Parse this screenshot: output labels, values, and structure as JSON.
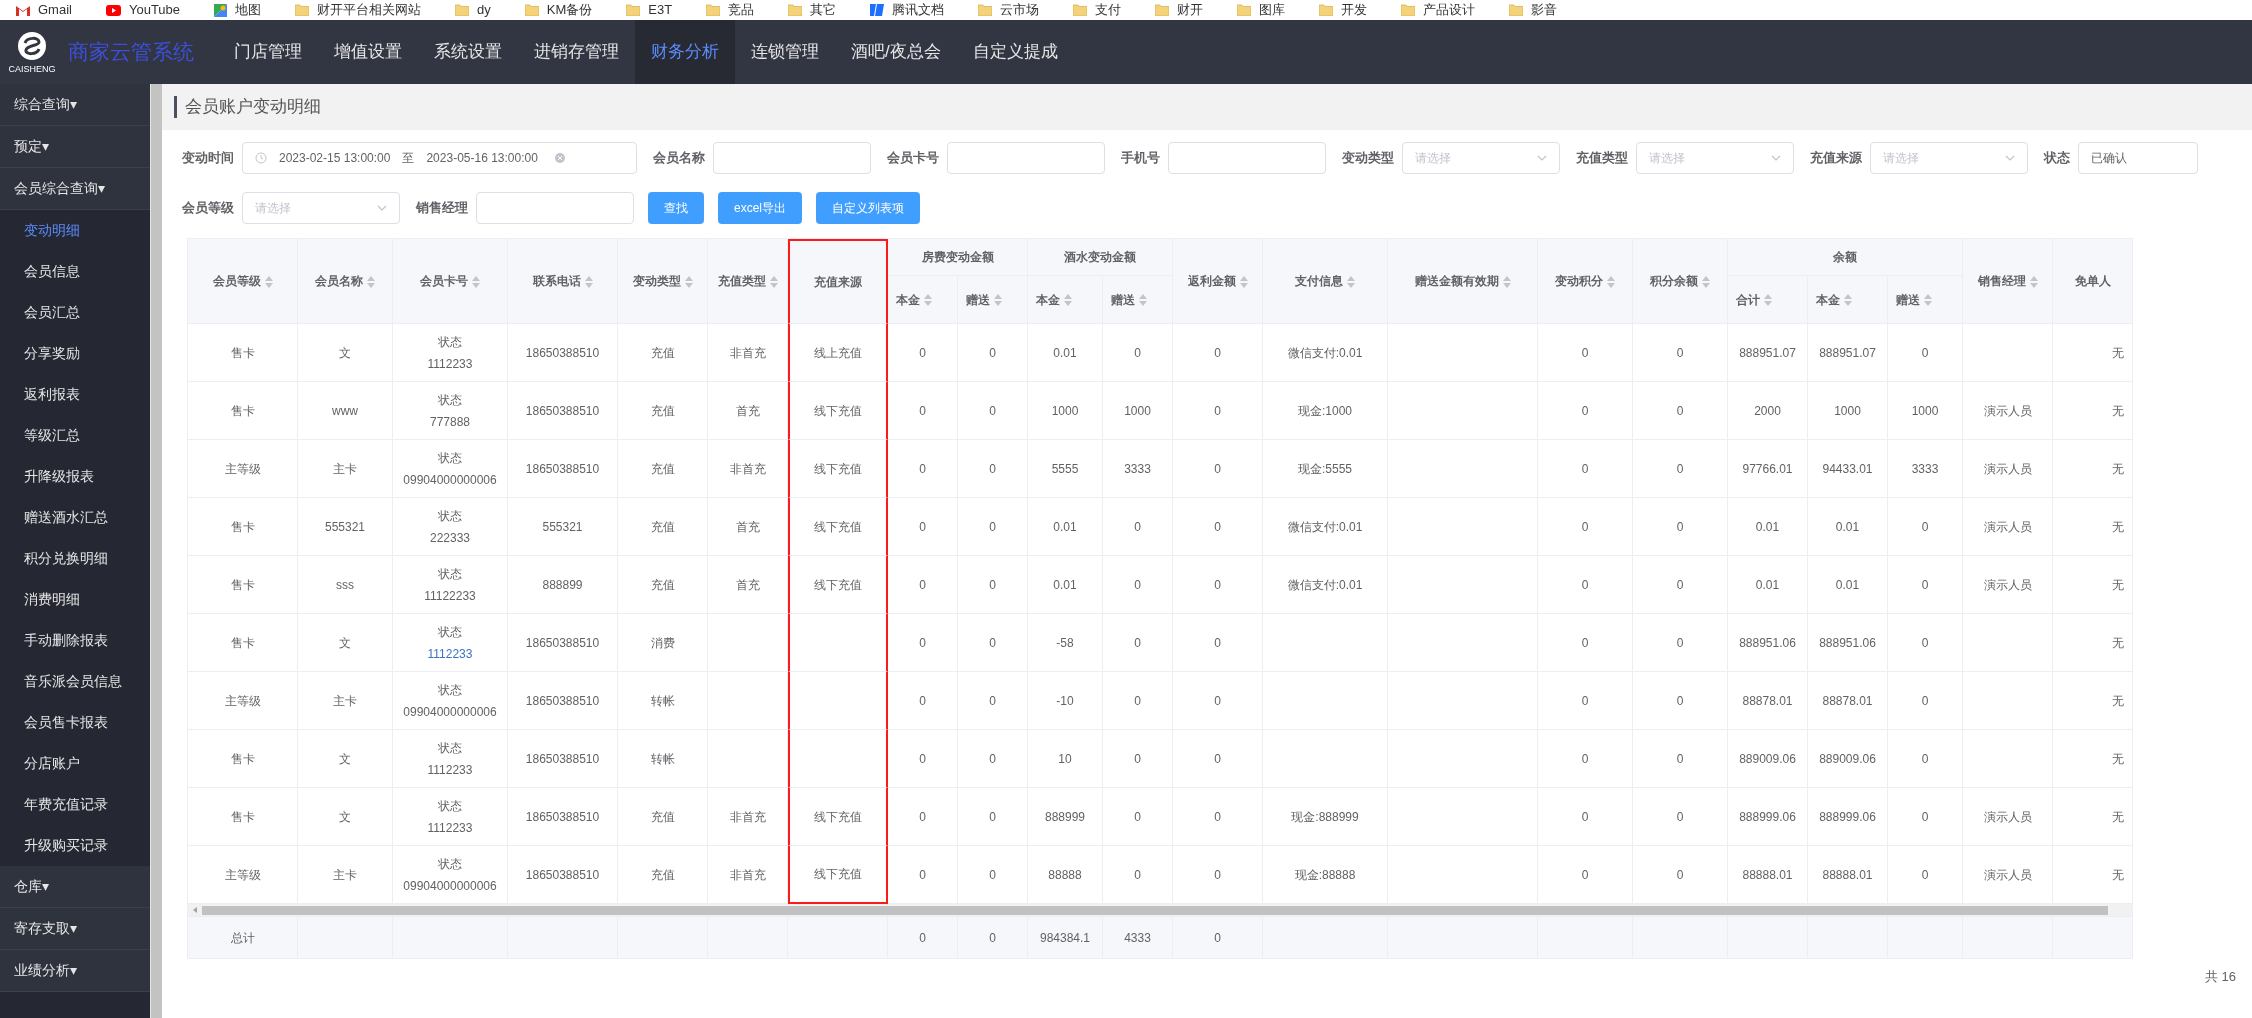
{
  "bookmarks": [
    {
      "label": "Gmail",
      "kind": "gmail"
    },
    {
      "label": "YouTube",
      "kind": "youtube"
    },
    {
      "label": "地图",
      "kind": "maps"
    },
    {
      "label": "财开平台相关网站",
      "kind": "folder"
    },
    {
      "label": "dy",
      "kind": "folder"
    },
    {
      "label": "KM备份",
      "kind": "folder"
    },
    {
      "label": "E3T",
      "kind": "folder"
    },
    {
      "label": "竞品",
      "kind": "folder"
    },
    {
      "label": "其它",
      "kind": "folder"
    },
    {
      "label": "腾讯文档",
      "kind": "docs"
    },
    {
      "label": "云市场",
      "kind": "folder"
    },
    {
      "label": "支付",
      "kind": "folder"
    },
    {
      "label": "财开",
      "kind": "folder"
    },
    {
      "label": "图库",
      "kind": "folder"
    },
    {
      "label": "开发",
      "kind": "folder"
    },
    {
      "label": "产品设计",
      "kind": "folder"
    },
    {
      "label": "影音",
      "kind": "folder"
    }
  ],
  "header": {
    "logo_text": "CAISHENG",
    "title": "商家云管系统",
    "nav": [
      {
        "label": "门店管理",
        "selected": false
      },
      {
        "label": "增值设置",
        "selected": false
      },
      {
        "label": "系统设置",
        "selected": false
      },
      {
        "label": "进销存管理",
        "selected": false
      },
      {
        "label": "财务分析",
        "selected": true
      },
      {
        "label": "连锁管理",
        "selected": false
      },
      {
        "label": "酒吧/夜总会",
        "selected": false
      },
      {
        "label": "自定义提成",
        "selected": false
      }
    ]
  },
  "sidebar": {
    "groups": [
      {
        "label": "综合查询",
        "caret": "▾"
      },
      {
        "label": "预定",
        "caret": "▾"
      },
      {
        "label": "会员综合查询",
        "caret": "▾",
        "items": [
          {
            "label": "变动明细",
            "selected": true
          },
          {
            "label": "会员信息",
            "selected": false
          },
          {
            "label": "会员汇总",
            "selected": false
          },
          {
            "label": "分享奖励",
            "selected": false
          },
          {
            "label": "返利报表",
            "selected": false
          },
          {
            "label": "等级汇总",
            "selected": false
          },
          {
            "label": "升降级报表",
            "selected": false
          },
          {
            "label": "赠送酒水汇总",
            "selected": false
          },
          {
            "label": "积分兑换明细",
            "selected": false
          },
          {
            "label": "消费明细",
            "selected": false
          },
          {
            "label": "手动删除报表",
            "selected": false
          },
          {
            "label": "音乐派会员信息",
            "selected": false
          },
          {
            "label": "会员售卡报表",
            "selected": false
          },
          {
            "label": "分店账户",
            "selected": false
          },
          {
            "label": "年费充值记录",
            "selected": false
          },
          {
            "label": "升级购买记录",
            "selected": false
          }
        ]
      },
      {
        "label": "仓库",
        "caret": "▾"
      },
      {
        "label": "寄存支取",
        "caret": "▾"
      },
      {
        "label": "业绩分析",
        "caret": "▾"
      }
    ]
  },
  "page_title": "会员账户变动明细",
  "filters": [
    {
      "label": "变动时间",
      "kind": "daterange",
      "start": "2023-02-15 13:00:00",
      "separator": "至",
      "end": "2023-05-16 13:00:00"
    },
    {
      "label": "会员名称",
      "kind": "input"
    },
    {
      "label": "会员卡号",
      "kind": "input"
    },
    {
      "label": "手机号",
      "kind": "input"
    },
    {
      "label": "变动类型",
      "kind": "select",
      "placeholder": "请选择"
    },
    {
      "label": "充值类型",
      "kind": "select",
      "placeholder": "请选择"
    },
    {
      "label": "充值来源",
      "kind": "select",
      "placeholder": "请选择"
    },
    {
      "label": "状态",
      "kind": "select",
      "value": "已确认"
    },
    {
      "label": "会员等级",
      "kind": "select",
      "placeholder": "请选择"
    },
    {
      "label": "销售经理",
      "kind": "input"
    }
  ],
  "buttons": [
    "查找",
    "excel导出",
    "自定义列表项"
  ],
  "table": {
    "columns": [
      {
        "label": "会员等级",
        "sortable": true
      },
      {
        "label": "会员名称",
        "sortable": true
      },
      {
        "label": "会员卡号",
        "sortable": true
      },
      {
        "label": "联系电话",
        "sortable": true
      },
      {
        "label": "变动类型",
        "sortable": true
      },
      {
        "label": "充值类型",
        "sortable": true
      },
      {
        "label": "充值来源",
        "sortable": false,
        "highlighted": true
      },
      {
        "label": "房费变动金额",
        "colspan": 2,
        "children": [
          {
            "label": "本金",
            "sortable": true
          },
          {
            "label": "赠送",
            "sortable": true
          }
        ]
      },
      {
        "label": "酒水变动金额",
        "colspan": 2,
        "children": [
          {
            "label": "本金",
            "sortable": true
          },
          {
            "label": "赠送",
            "sortable": true
          }
        ]
      },
      {
        "label": "返利金额",
        "sortable": true
      },
      {
        "label": "支付信息",
        "sortable": true
      },
      {
        "label": "赠送金额有效期",
        "sortable": true
      },
      {
        "label": "变动积分",
        "sortable": true
      },
      {
        "label": "积分余额",
        "sortable": true
      },
      {
        "label": "余额",
        "colspan": 3,
        "children": [
          {
            "label": "合计",
            "sortable": true
          },
          {
            "label": "本金",
            "sortable": true
          },
          {
            "label": "赠送",
            "sortable": true
          }
        ]
      },
      {
        "label": "销售经理",
        "sortable": true
      },
      {
        "label": "免单人",
        "sortable": false
      }
    ],
    "rows": [
      {
        "level": "售卡",
        "name": "文",
        "card_status": "状态",
        "card_number": "1112233",
        "card_link": false,
        "phone": "18650388510",
        "change_type": "充值",
        "recharge_type": "非首充",
        "recharge_source": "线上充值",
        "room_principal": "0",
        "room_bonus": "0",
        "drink_principal": "0.01",
        "drink_bonus": "0",
        "rebate": "0",
        "payment": "微信支付:0.01",
        "points_change": "0",
        "points_balance": "0",
        "balance_total": "888951.07",
        "balance_principal": "888951.07",
        "balance_bonus": "0",
        "waiver": "无"
      },
      {
        "level": "售卡",
        "name": "www",
        "card_status": "状态",
        "card_number": "777888",
        "card_link": false,
        "phone": "18650388510",
        "change_type": "充值",
        "recharge_type": "首充",
        "recharge_source": "线下充值",
        "room_principal": "0",
        "room_bonus": "0",
        "drink_principal": "1000",
        "drink_bonus": "1000",
        "rebate": "0",
        "payment": "现金:1000",
        "points_change": "0",
        "points_balance": "0",
        "balance_total": "2000",
        "balance_principal": "1000",
        "balance_bonus": "1000",
        "sales_manager": "演示人员",
        "waiver": "无"
      },
      {
        "level": "主等级",
        "name": "主卡",
        "card_status": "状态",
        "card_number": "09904000000006",
        "card_link": false,
        "phone": "18650388510",
        "change_type": "充值",
        "recharge_type": "非首充",
        "recharge_source": "线下充值",
        "room_principal": "0",
        "room_bonus": "0",
        "drink_principal": "5555",
        "drink_bonus": "3333",
        "rebate": "0",
        "payment": "现金:5555",
        "points_change": "0",
        "points_balance": "0",
        "balance_total": "97766.01",
        "balance_principal": "94433.01",
        "balance_bonus": "3333",
        "sales_manager": "演示人员",
        "waiver": "无"
      },
      {
        "level": "售卡",
        "name": "555321",
        "card_status": "状态",
        "card_number": "222333",
        "card_link": false,
        "phone": "555321",
        "change_type": "充值",
        "recharge_type": "首充",
        "recharge_source": "线下充值",
        "room_principal": "0",
        "room_bonus": "0",
        "drink_principal": "0.01",
        "drink_bonus": "0",
        "rebate": "0",
        "payment": "微信支付:0.01",
        "points_change": "0",
        "points_balance": "0",
        "balance_total": "0.01",
        "balance_principal": "0.01",
        "balance_bonus": "0",
        "sales_manager": "演示人员",
        "waiver": "无"
      },
      {
        "level": "售卡",
        "name": "sss",
        "card_status": "状态",
        "card_number": "11122233",
        "card_link": false,
        "phone": "888899",
        "change_type": "充值",
        "recharge_type": "首充",
        "recharge_source": "线下充值",
        "room_principal": "0",
        "room_bonus": "0",
        "drink_principal": "0.01",
        "drink_bonus": "0",
        "rebate": "0",
        "payment": "微信支付:0.01",
        "points_change": "0",
        "points_balance": "0",
        "balance_total": "0.01",
        "balance_principal": "0.01",
        "balance_bonus": "0",
        "sales_manager": "演示人员",
        "waiver": "无"
      },
      {
        "level": "售卡",
        "name": "文",
        "card_status": "状态",
        "card_number": "1112233",
        "card_link": true,
        "phone": "18650388510",
        "change_type": "消费",
        "room_principal": "0",
        "room_bonus": "0",
        "drink_principal": "-58",
        "drink_bonus": "0",
        "rebate": "0",
        "points_change": "0",
        "points_balance": "0",
        "balance_total": "888951.06",
        "balance_principal": "888951.06",
        "balance_bonus": "0",
        "waiver": "无"
      },
      {
        "level": "主等级",
        "name": "主卡",
        "card_status": "状态",
        "card_number": "09904000000006",
        "card_link": false,
        "phone": "18650388510",
        "change_type": "转帐",
        "room_principal": "0",
        "room_bonus": "0",
        "drink_principal": "-10",
        "drink_bonus": "0",
        "rebate": "0",
        "points_change": "0",
        "points_balance": "0",
        "balance_total": "88878.01",
        "balance_principal": "88878.01",
        "balance_bonus": "0",
        "waiver": "无"
      },
      {
        "level": "售卡",
        "name": "文",
        "card_status": "状态",
        "card_number": "1112233",
        "card_link": false,
        "phone": "18650388510",
        "change_type": "转帐",
        "room_principal": "0",
        "room_bonus": "0",
        "drink_principal": "10",
        "drink_bonus": "0",
        "rebate": "0",
        "points_change": "0",
        "points_balance": "0",
        "balance_total": "889009.06",
        "balance_principal": "889009.06",
        "balance_bonus": "0",
        "waiver": "无"
      },
      {
        "level": "售卡",
        "name": "文",
        "card_status": "状态",
        "card_number": "1112233",
        "card_link": false,
        "phone": "18650388510",
        "change_type": "充值",
        "recharge_type": "非首充",
        "recharge_source": "线下充值",
        "room_principal": "0",
        "room_bonus": "0",
        "drink_principal": "888999",
        "drink_bonus": "0",
        "rebate": "0",
        "payment": "现金:888999",
        "points_change": "0",
        "points_balance": "0",
        "balance_total": "888999.06",
        "balance_principal": "888999.06",
        "balance_bonus": "0",
        "sales_manager": "演示人员",
        "waiver": "无"
      },
      {
        "level": "主等级",
        "name": "主卡",
        "card_status": "状态",
        "card_number": "09904000000006",
        "card_link": false,
        "phone": "18650388510",
        "change_type": "充值",
        "recharge_type": "非首充",
        "recharge_source": "线下充值",
        "room_principal": "0",
        "room_bonus": "0",
        "drink_principal": "88888",
        "drink_bonus": "0",
        "rebate": "0",
        "payment": "现金:88888",
        "points_change": "0",
        "points_balance": "0",
        "balance_total": "88888.01",
        "balance_principal": "88888.01",
        "balance_bonus": "0",
        "sales_manager": "演示人员",
        "waiver": "无"
      }
    ],
    "totals": {
      "level": "总计",
      "room_principal": "0",
      "room_bonus": "0",
      "drink_principal": "984384.1",
      "drink_bonus": "4333",
      "rebate": "0"
    }
  },
  "pagination": {
    "total": "共 16"
  }
}
